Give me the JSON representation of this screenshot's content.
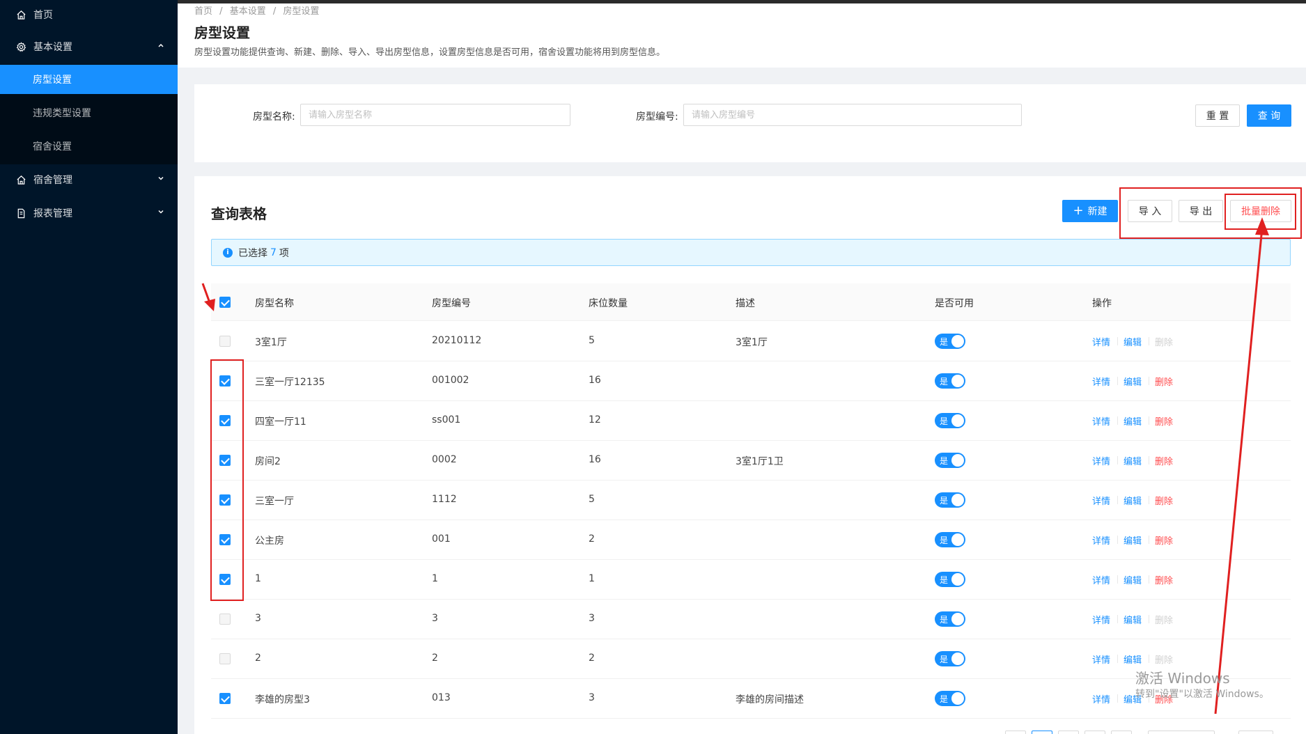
{
  "sidebar": {
    "items": [
      {
        "label": "首页",
        "icon": "home-icon"
      },
      {
        "label": "基本设置",
        "icon": "gear-icon",
        "expanded": true
      },
      {
        "label": "房型设置",
        "active": true
      },
      {
        "label": "违规类型设置"
      },
      {
        "label": "宿舍设置"
      },
      {
        "label": "宿舍管理",
        "icon": "home-icon"
      },
      {
        "label": "报表管理",
        "icon": "file-icon"
      }
    ]
  },
  "header": {
    "breadcrumb": [
      "首页",
      "/",
      "基本设置",
      "/",
      "房型设置"
    ],
    "title": "房型设置",
    "description": "房型设置功能提供查询、新建、删除、导入、导出房型信息，设置房型信息是否可用，宿舍设置功能将用到房型信息。"
  },
  "search": {
    "name_label": "房型名称:",
    "name_placeholder": "请输入房型名称",
    "code_label": "房型编号:",
    "code_placeholder": "请输入房型编号",
    "reset_label": "重 置",
    "query_label": "查 询"
  },
  "table_card": {
    "title": "查询表格",
    "new_label": "新建",
    "import_label": "导 入",
    "export_label": "导 出",
    "batch_delete_label": "批量删除",
    "alert": {
      "prefix": "已选择",
      "count": "7",
      "suffix": "项"
    },
    "columns": [
      "房型名称",
      "房型编号",
      "床位数量",
      "描述",
      "是否可用",
      "操作"
    ],
    "rows": [
      {
        "name": "3室1厅",
        "code": "20210112",
        "beds": "5",
        "desc": "3室1厅",
        "enabled": "是",
        "checked": false,
        "deletable": false
      },
      {
        "name": "三室一厅12135",
        "code": "001002",
        "beds": "16",
        "desc": "",
        "enabled": "是",
        "checked": true,
        "deletable": true
      },
      {
        "name": "四室一厅11",
        "code": "ss001",
        "beds": "12",
        "desc": "",
        "enabled": "是",
        "checked": true,
        "deletable": true
      },
      {
        "name": "房间2",
        "code": "0002",
        "beds": "16",
        "desc": "3室1厅1卫",
        "enabled": "是",
        "checked": true,
        "deletable": true
      },
      {
        "name": "三室一厅",
        "code": "1112",
        "beds": "5",
        "desc": "",
        "enabled": "是",
        "checked": true,
        "deletable": true
      },
      {
        "name": "公主房",
        "code": "001",
        "beds": "2",
        "desc": "",
        "enabled": "是",
        "checked": true,
        "deletable": true
      },
      {
        "name": "1",
        "code": "1",
        "beds": "1",
        "desc": "",
        "enabled": "是",
        "checked": true,
        "deletable": true
      },
      {
        "name": "3",
        "code": "3",
        "beds": "3",
        "desc": "",
        "enabled": "是",
        "checked": false,
        "deletable": false
      },
      {
        "name": "2",
        "code": "2",
        "beds": "2",
        "desc": "",
        "enabled": "是",
        "checked": false,
        "deletable": false
      },
      {
        "name": "李雄的房型3",
        "code": "013",
        "beds": "3",
        "desc": "李雄的房间描述",
        "enabled": "是",
        "checked": true,
        "deletable": true
      }
    ],
    "actions": {
      "detail": "详情",
      "edit": "编辑",
      "delete": "删除"
    }
  },
  "watermark": {
    "line1": "激活 Windows",
    "line2": "转到\"设置\"以激活 Windows。"
  },
  "colors": {
    "sidebar": "#001529",
    "primary": "#1890ff",
    "danger": "#ff4d4f",
    "annotation": "#e02020"
  }
}
